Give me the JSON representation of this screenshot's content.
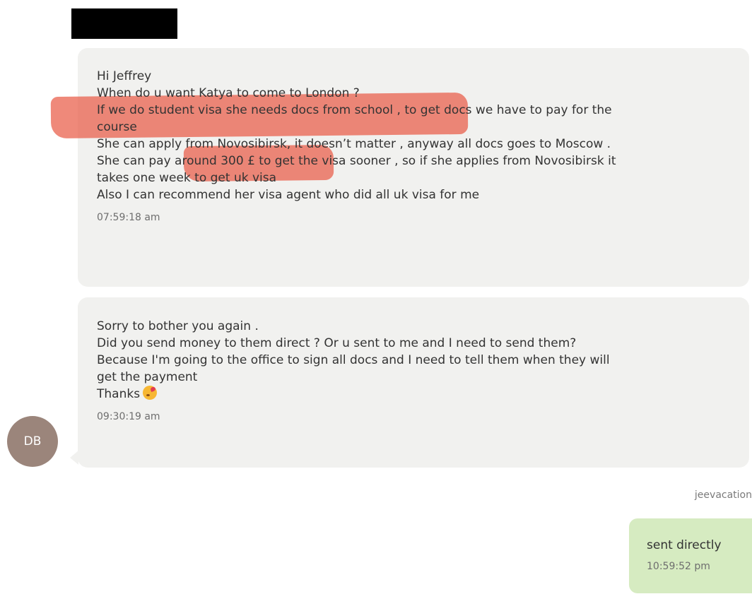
{
  "conversation": {
    "messages": [
      {
        "lines": [
          "Hi Jeffrey",
          "When do u want Katya to come to London ?",
          "If we do student visa she needs docs from school , to get docs we have to pay for the",
          "course",
          "She can apply from Novosibirsk, it doesn’t matter , anyway all docs goes to Moscow .",
          "She can pay around 300 £ to get the visa sooner , so if she applies from Novosibirsk it",
          "takes one week to get uk visa",
          "Also I can recommend her visa agent who did all uk visa for me"
        ],
        "timestamp": "07:59:18 am"
      },
      {
        "lines": [
          "Sorry to bother you again .",
          "Did you send money to them direct ? Or u sent to me and I need to send them?",
          "Because I'm going to the office to sign all docs and I need to tell them when they will",
          "get the payment",
          "Thanks"
        ],
        "emoji": "kissing-face-emoji",
        "timestamp": "09:30:19 am"
      }
    ],
    "sender_avatar_initials": "DB",
    "reply": {
      "sender_name": "jeevacation",
      "text": "sent directly",
      "timestamp": "10:59:52 pm"
    }
  },
  "colors": {
    "incoming_bubble": "#f1f1ef",
    "outgoing_bubble": "#d6ebc1",
    "highlight": "#e95c46",
    "avatar": "#9b857b",
    "redaction": "#000000"
  }
}
